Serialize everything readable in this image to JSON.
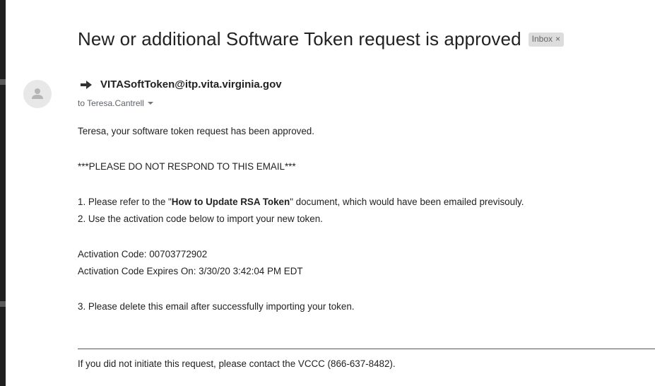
{
  "email": {
    "subject": "New or additional Software Token request is approved",
    "label_chip": "Inbox",
    "label_chip_close": "×",
    "sender": "VITASoftToken@itp.vita.virginia.gov",
    "recipient": "to Teresa.Cantrell",
    "body": {
      "greeting": "Teresa, your software token request has been approved.",
      "warning": "***PLEASE DO NOT RESPOND TO THIS EMAIL***",
      "step1_prefix": "1. Please refer to the \"",
      "step1_doc": "How to Update RSA Token",
      "step1_suffix": "\" document, which would have been emailed previsouly.",
      "step2": "2. Use the activation code below to import your new token.",
      "activation_code": "Activation Code: 00703772902",
      "activation_expires": "Activation Code Expires On: 3/30/20 3:42:04 PM EDT",
      "step3": "3. Please delete this email after successfully importing your token.",
      "footer": "If you did not initiate this request, please contact the VCCC (866-637-8482)."
    }
  }
}
